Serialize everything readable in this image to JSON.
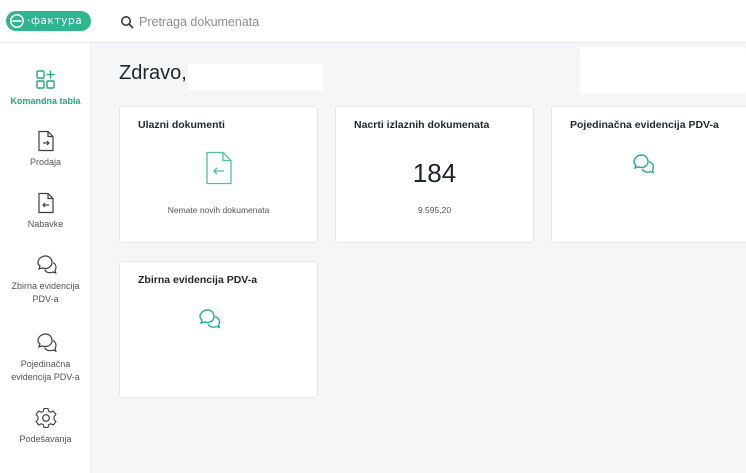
{
  "app": {
    "logo_text": "·фактура",
    "colors": {
      "accent": "#2fb58f",
      "accent_dark": "#21a884",
      "chat_icon": "#2ba9a0"
    }
  },
  "search": {
    "placeholder": "Pretraga dokumenata",
    "value": ""
  },
  "sidebar": {
    "items": [
      {
        "label": "Komandna tabla",
        "icon": "dashboard-grid-icon",
        "active": true
      },
      {
        "label": "Prodaja",
        "icon": "document-arrow-right-icon",
        "active": false
      },
      {
        "label": "Nabavke",
        "icon": "document-arrow-left-icon",
        "active": false
      },
      {
        "label": "Zbirna evidencija PDV-a",
        "icon": "chat-bubbles-icon",
        "active": false
      },
      {
        "label": "Pojedinačna evidencija PDV-a",
        "icon": "chat-bubbles-icon",
        "active": false
      },
      {
        "label": "Podešavanja",
        "icon": "gear-icon",
        "active": false
      }
    ]
  },
  "main": {
    "greeting": "Zdravo,",
    "cards": [
      {
        "title": "Ulazni dokumenti",
        "subtitle": "Nemate novih dokumenata",
        "icon": "document-arrow-left-icon"
      },
      {
        "title": "Nacrti izlaznih dokumenata",
        "value": "184",
        "subtitle": "9.595,20"
      },
      {
        "title": "Pojedinačna evidencija PDV-a",
        "icon": "chat-bubbles-icon"
      },
      {
        "title": "Zbirna evidencija PDV-a",
        "icon": "chat-bubbles-icon"
      }
    ]
  }
}
